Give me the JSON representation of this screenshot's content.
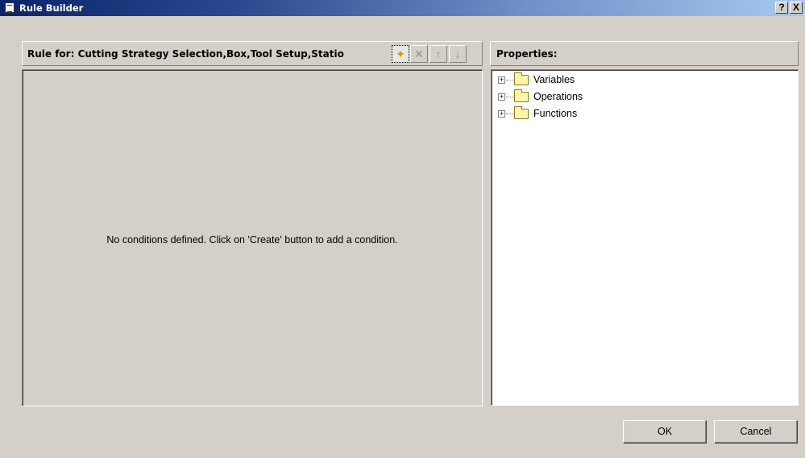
{
  "window": {
    "title": "Rule Builder",
    "help_label": "?",
    "close_label": "X"
  },
  "rule_panel": {
    "header_label": "Rule for: Cutting Strategy Selection,Box,Tool Setup,Statio",
    "toolbar": {
      "create_icon": "create-icon",
      "delete_icon": "delete-icon",
      "move_up_icon": "arrow-up-icon",
      "move_down_icon": "arrow-down-icon"
    },
    "empty_message": "No conditions defined.  Click on 'Create' button to add a condition."
  },
  "properties_panel": {
    "header_label": "Properties:",
    "tree": [
      {
        "label": "Variables",
        "expander": "+"
      },
      {
        "label": "Operations",
        "expander": "+"
      },
      {
        "label": "Functions",
        "expander": "+"
      }
    ]
  },
  "buttons": {
    "ok_label": "OK",
    "cancel_label": "Cancel"
  }
}
